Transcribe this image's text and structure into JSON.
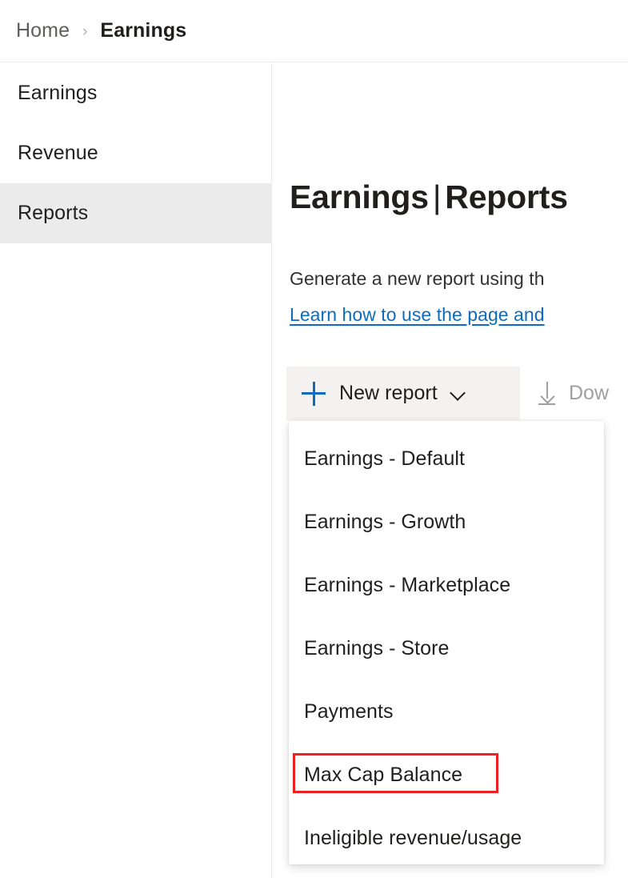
{
  "breadcrumb": {
    "home_label": "Home",
    "separator": "›",
    "current_label": "Earnings"
  },
  "sidebar": {
    "items": [
      {
        "label": "Earnings",
        "selected": false
      },
      {
        "label": "Revenue",
        "selected": false
      },
      {
        "label": "Reports",
        "selected": true
      }
    ]
  },
  "main": {
    "title_primary": "Earnings",
    "title_divider": "|",
    "title_secondary": "Reports",
    "description": "Generate a new report using th",
    "help_link": "Learn how to use the page and"
  },
  "toolbar": {
    "new_report_label": "New report",
    "new_report_icon": "plus-icon",
    "new_report_chevron": "chevron-down-icon",
    "download_label": "Dow",
    "download_icon": "download-icon",
    "download_disabled": true
  },
  "dropdown": {
    "items": [
      {
        "label": "Earnings - Default",
        "highlighted": false
      },
      {
        "label": "Earnings - Growth",
        "highlighted": false
      },
      {
        "label": "Earnings - Marketplace",
        "highlighted": false
      },
      {
        "label": "Earnings - Store",
        "highlighted": false
      },
      {
        "label": "Payments",
        "highlighted": false
      },
      {
        "label": "Max Cap Balance",
        "highlighted": true
      },
      {
        "label": "Ineligible revenue/usage",
        "highlighted": false
      }
    ]
  },
  "colors": {
    "accent_blue": "#0f6cbd",
    "link_blue": "#0f6cbd",
    "annotation_red": "#ed2024",
    "selected_nav_bg": "#ebebeb",
    "command_active_bg": "#f3f2f1",
    "disabled_text": "#a19f9d",
    "text_primary": "#201f1e",
    "text_secondary": "#605e5c",
    "divider": "#edebe9"
  }
}
